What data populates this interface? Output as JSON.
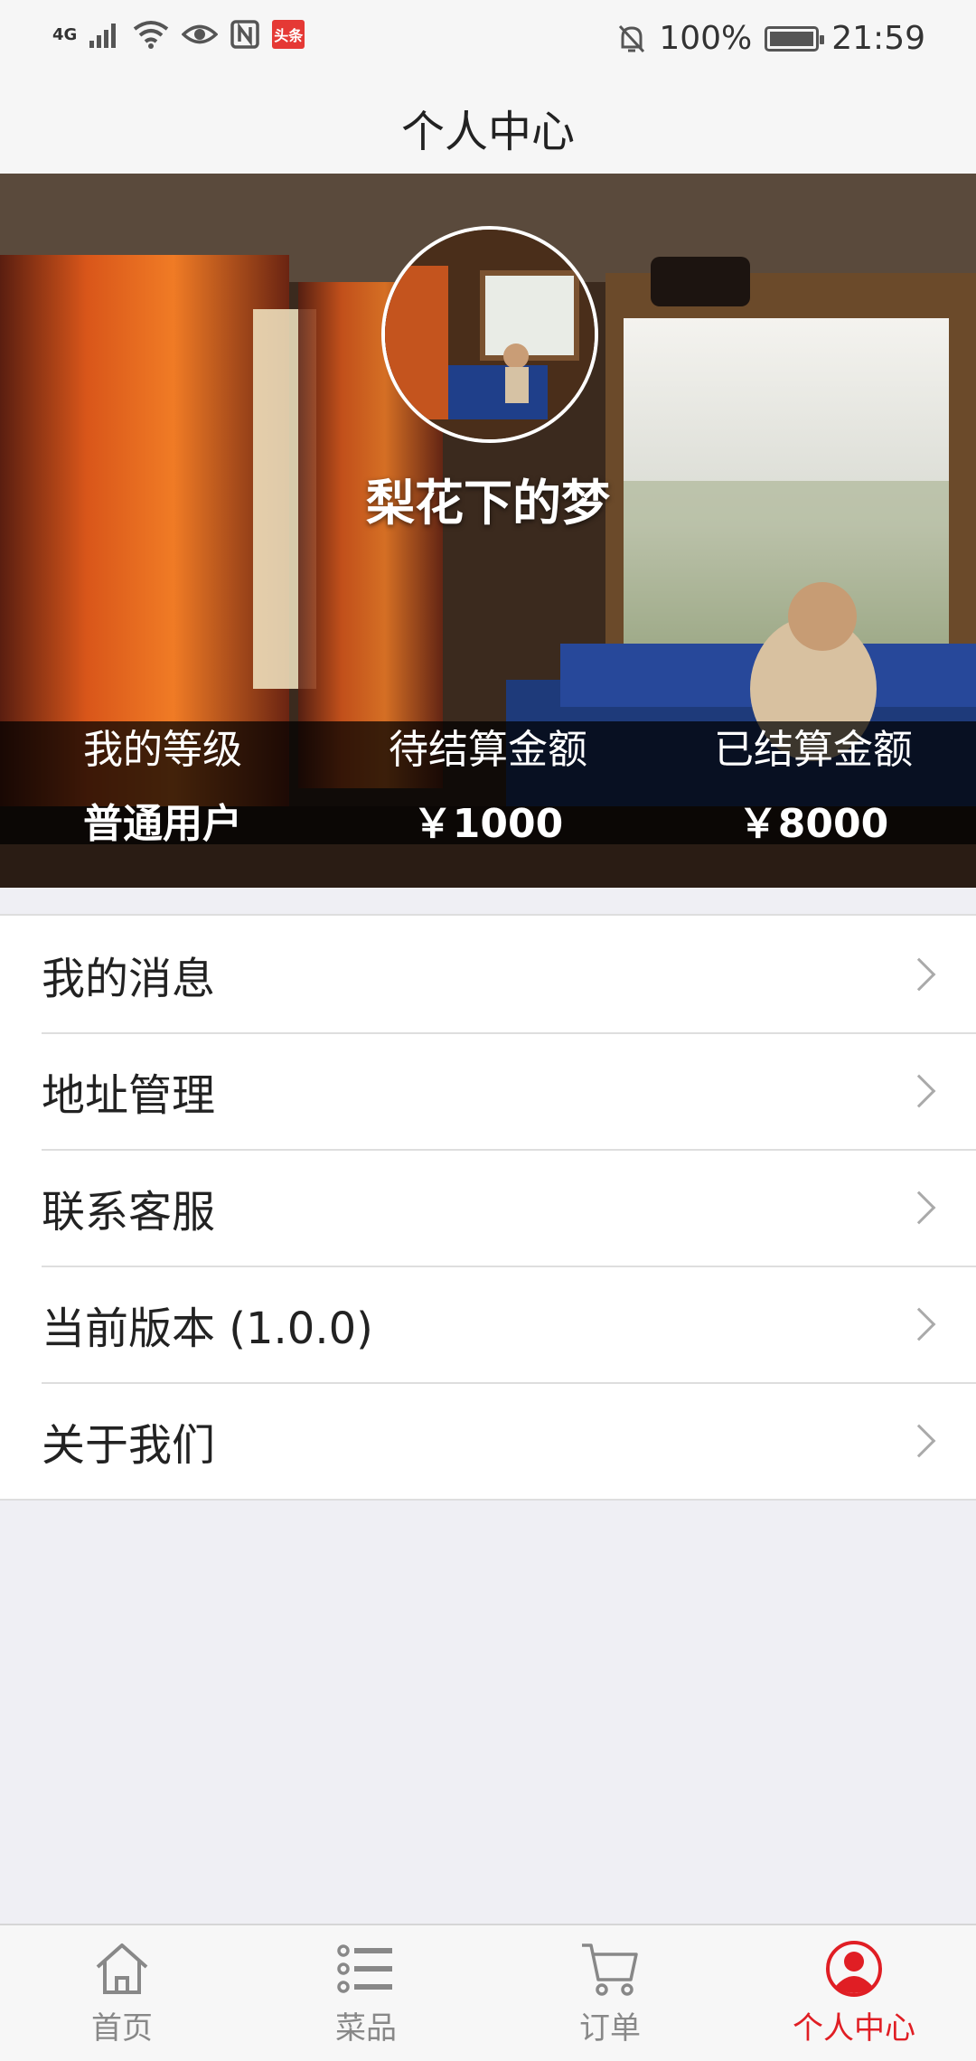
{
  "status_bar": {
    "network": "4G",
    "battery": "100%",
    "time": "21:59",
    "app_badge": "头条"
  },
  "header": {
    "title": "个人中心"
  },
  "profile": {
    "name": "梨花下的梦",
    "stats": [
      {
        "label": "我的等级",
        "value": "普通用户"
      },
      {
        "label": "待结算金额",
        "value": "￥1000"
      },
      {
        "label": "已结算金额",
        "value": "￥8000"
      }
    ]
  },
  "menu": {
    "items": [
      {
        "label": "我的消息"
      },
      {
        "label": "地址管理"
      },
      {
        "label": "联系客服"
      },
      {
        "label": "当前版本 (1.0.0)"
      },
      {
        "label": "关于我们"
      }
    ]
  },
  "tabbar": {
    "tabs": [
      {
        "label": "首页",
        "icon": "home-icon"
      },
      {
        "label": "菜品",
        "icon": "list-icon"
      },
      {
        "label": "订单",
        "icon": "cart-icon"
      },
      {
        "label": "个人中心",
        "icon": "user-icon"
      }
    ],
    "active_index": 3,
    "active_color": "#e01e24"
  }
}
